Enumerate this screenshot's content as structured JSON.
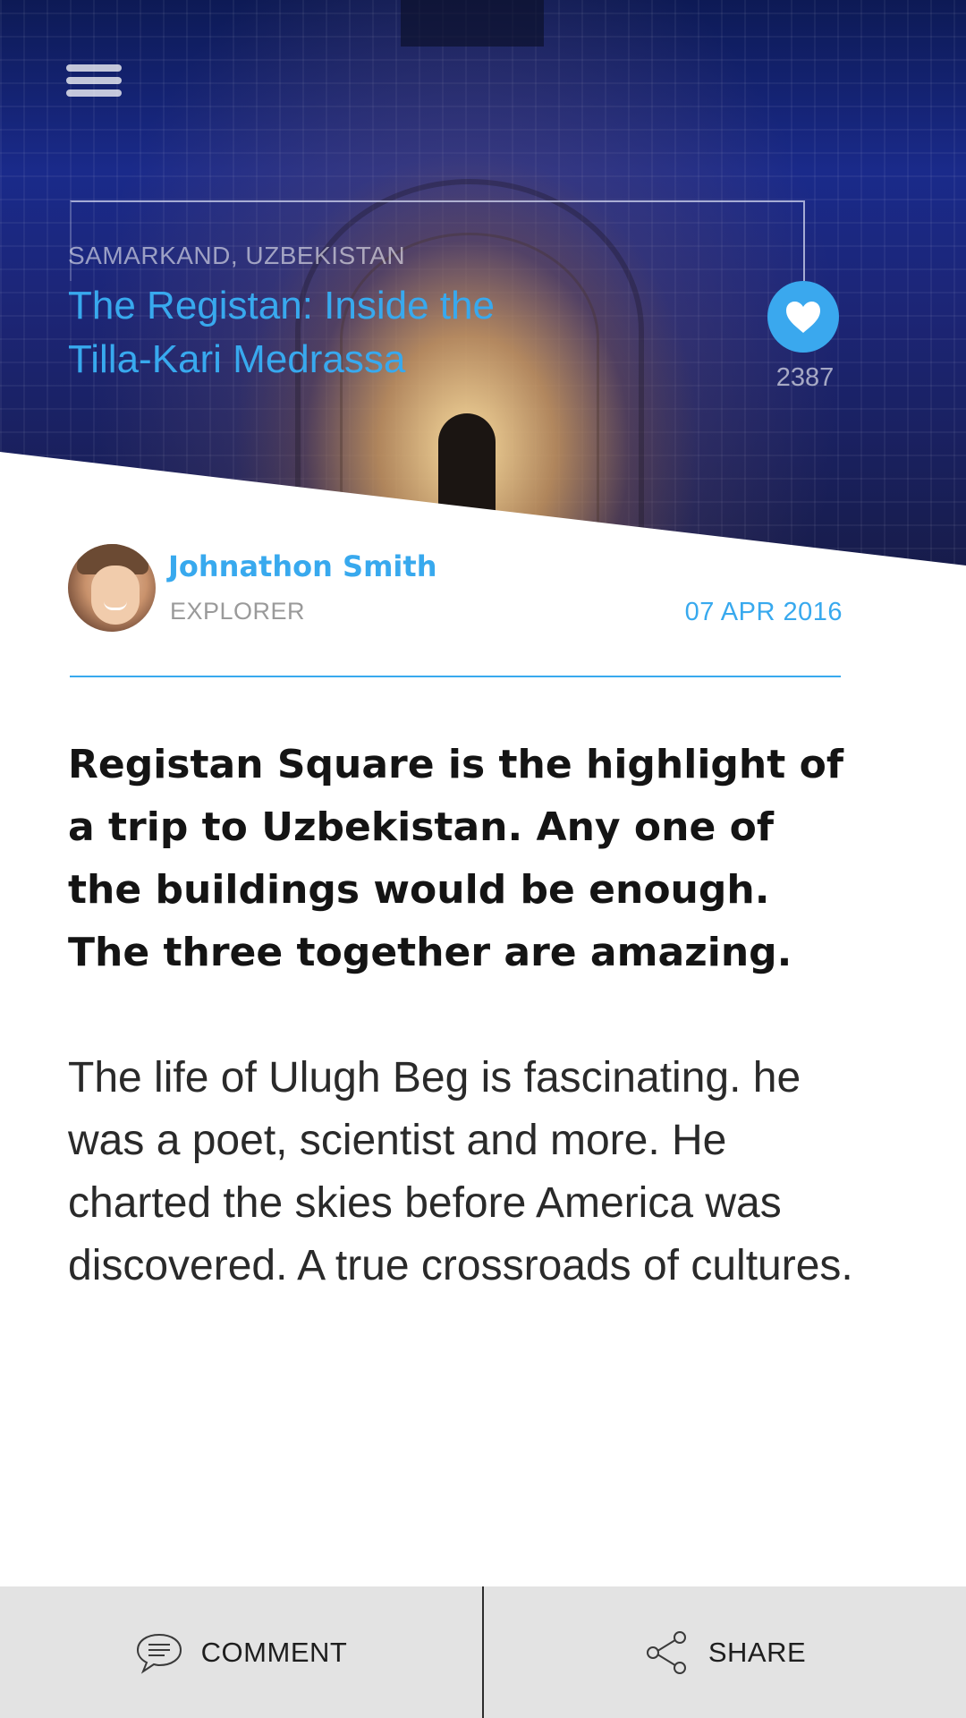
{
  "header": {
    "menu_icon": "hamburger-menu-icon",
    "location": "SAMARKAND, UZBEKISTAN",
    "title": "The Registan: Inside the Tilla-Kari Medrassa",
    "like_icon": "heart-icon",
    "like_count": "2387"
  },
  "author": {
    "name": "Johnathon Smith",
    "role": "EXPLORER",
    "date": "07 APR 2016"
  },
  "article": {
    "lead": "Registan Square is the highlight of a trip to Uzbekistan. Any one of the buildings would be enough. The three together are amazing.",
    "body": "The life of Ulugh Beg is fascinating. he was a poet, scientist and more. He charted the skies before America was discovered. A true crossroads of cultures."
  },
  "actions": {
    "comment_icon": "comment-bubble-icon",
    "comment_label": "COMMENT",
    "share_icon": "share-icon",
    "share_label": "SHARE"
  },
  "colors": {
    "accent": "#38a9ee",
    "bottom_bar": "#e3e3e3",
    "lead_text": "#141414"
  }
}
